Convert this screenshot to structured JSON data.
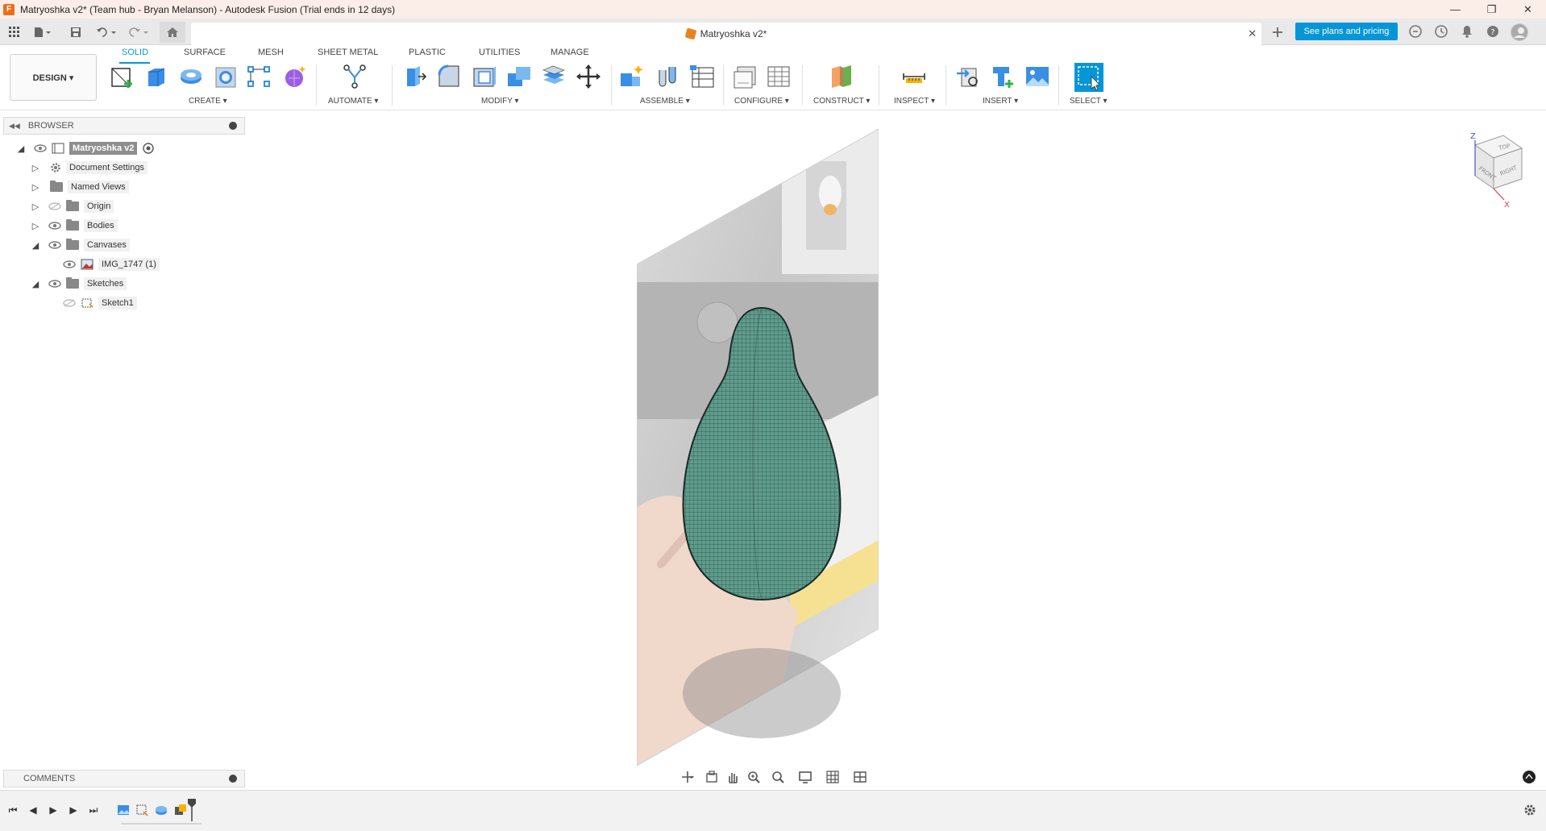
{
  "window": {
    "title": "Matryoshka v2* (Team hub - Bryan Melanson) - Autodesk Fusion (Trial ends in 12 days)",
    "controls": [
      "—",
      "❐",
      "✕"
    ]
  },
  "quickbar": {
    "doc_tab_title": "Matryoshka v2*",
    "plans_button": "See plans and pricing"
  },
  "ribbon": {
    "workspace": "DESIGN ▾",
    "tabs": [
      "SOLID",
      "SURFACE",
      "MESH",
      "SHEET METAL",
      "PLASTIC",
      "UTILITIES",
      "MANAGE"
    ],
    "active_tab": "SOLID",
    "groups": {
      "create": "CREATE ▾",
      "automate": "AUTOMATE ▾",
      "modify": "MODIFY ▾",
      "assemble": "ASSEMBLE ▾",
      "configure": "CONFIGURE ▾",
      "construct": "CONSTRUCT ▾",
      "inspect": "INSPECT ▾",
      "insert": "INSERT ▾",
      "select": "SELECT ▾"
    },
    "accent": "#0696d7"
  },
  "browser": {
    "title": "BROWSER",
    "root": "Matryoshka v2",
    "items": [
      {
        "label": "Document Settings"
      },
      {
        "label": "Named Views"
      },
      {
        "label": "Origin"
      },
      {
        "label": "Bodies"
      },
      {
        "label": "Canvases"
      },
      {
        "label": "IMG_1747 (1)"
      },
      {
        "label": "Sketches"
      },
      {
        "label": "Sketch1"
      }
    ]
  },
  "comments": {
    "title": "COMMENTS"
  },
  "viewcube": {
    "top": "TOP",
    "front": "FRONT",
    "right": "RIGHT",
    "z_axis": "Z",
    "x_axis": "X"
  }
}
